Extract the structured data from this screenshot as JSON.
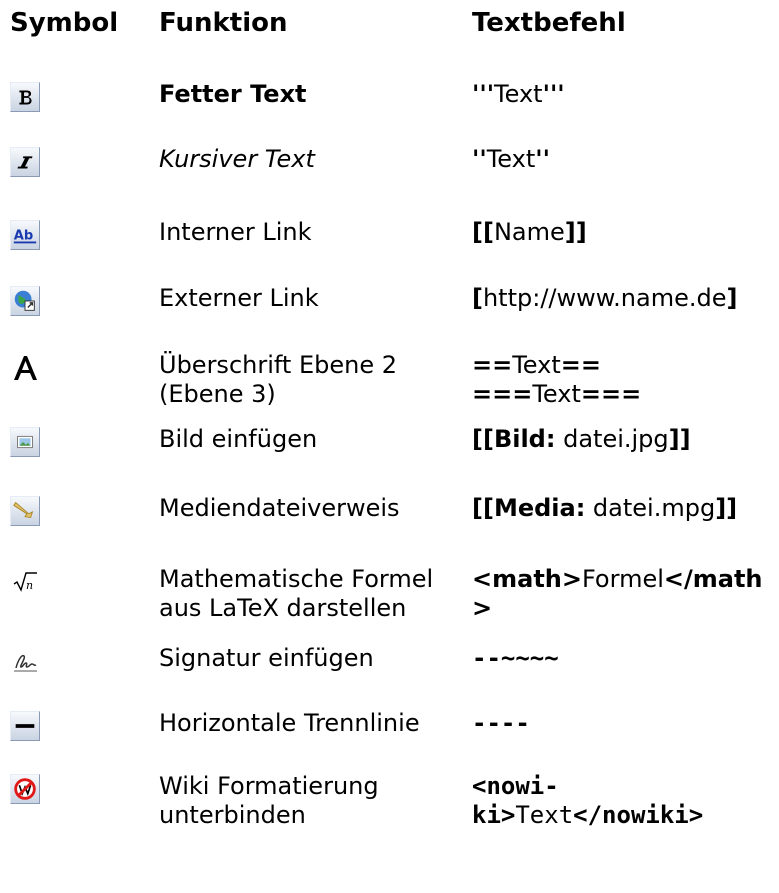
{
  "headers": {
    "symbol": "Symbol",
    "function": "Funktion",
    "command": "Textbefehl"
  },
  "rows": [
    {
      "icon": "bold-icon",
      "func": [
        "Fetter Text"
      ],
      "cmd": [
        [
          [
            "b",
            "'''"
          ],
          [
            "n",
            "Text"
          ],
          [
            "b",
            "'''"
          ]
        ]
      ]
    },
    {
      "icon": "italic-icon",
      "func": [
        "Kursiver Text"
      ],
      "cmd": [
        [
          [
            "b",
            "''"
          ],
          [
            "n",
            "Text"
          ],
          [
            "b",
            "''"
          ]
        ]
      ]
    },
    {
      "icon": "internal-link-icon",
      "func": [
        "Interner Link"
      ],
      "cmd": [
        [
          [
            "b",
            "[["
          ],
          [
            "n",
            "Name"
          ],
          [
            "b",
            "]]"
          ]
        ]
      ]
    },
    {
      "icon": "external-link-icon",
      "func": [
        "Externer Link"
      ],
      "cmd": [
        [
          [
            "b",
            "["
          ],
          [
            "n",
            "http://www.name.de"
          ],
          [
            "b",
            "]"
          ]
        ]
      ]
    },
    {
      "icon": "headline-icon",
      "func": [
        "Überschrift Ebene 2",
        "(Ebene 3)"
      ],
      "cmd": [
        [
          [
            "b",
            "=="
          ],
          [
            "n",
            "Text"
          ],
          [
            "b",
            "=="
          ]
        ],
        [
          [
            "b",
            "==="
          ],
          [
            "n",
            "Text"
          ],
          [
            "b",
            "==="
          ]
        ]
      ]
    },
    {
      "icon": "image-icon",
      "func": [
        "Bild einfügen"
      ],
      "cmd": [
        [
          [
            "b",
            "[[Bild:"
          ],
          [
            "n",
            " datei.jpg"
          ],
          [
            "b",
            "]]"
          ]
        ]
      ]
    },
    {
      "icon": "media-icon",
      "func": [
        "Mediendateiverweis"
      ],
      "cmd": [
        [
          [
            "b",
            "[[Media:"
          ],
          [
            "n",
            " datei.mpg"
          ],
          [
            "b",
            "]]"
          ]
        ]
      ]
    },
    {
      "icon": "math-icon",
      "func": [
        "Mathematische Formel",
        "aus LaTeX darstellen"
      ],
      "cmd": [
        [
          [
            "b",
            "<math>"
          ],
          [
            "n",
            "Formel"
          ],
          [
            "b",
            "</math"
          ]
        ],
        [
          [
            "b",
            ">"
          ]
        ]
      ]
    },
    {
      "icon": "signature-icon",
      "func": [
        "Signatur einfügen"
      ],
      "cmd": [
        [
          [
            "bm",
            "--~~~~"
          ]
        ]
      ]
    },
    {
      "icon": "horizontal-line-icon",
      "func": [
        "Horizontale Trennlinie"
      ],
      "cmd": [
        [
          [
            "bm",
            "----"
          ]
        ]
      ]
    },
    {
      "icon": "nowiki-icon",
      "func": [
        "Wiki Formatierung",
        "unterbinden"
      ],
      "cmd": [
        [
          [
            "bm",
            "<nowi-"
          ]
        ],
        [
          [
            "bm",
            "ki>"
          ],
          [
            "m",
            "Text"
          ],
          [
            "bm",
            "</nowiki>"
          ]
        ]
      ]
    }
  ]
}
